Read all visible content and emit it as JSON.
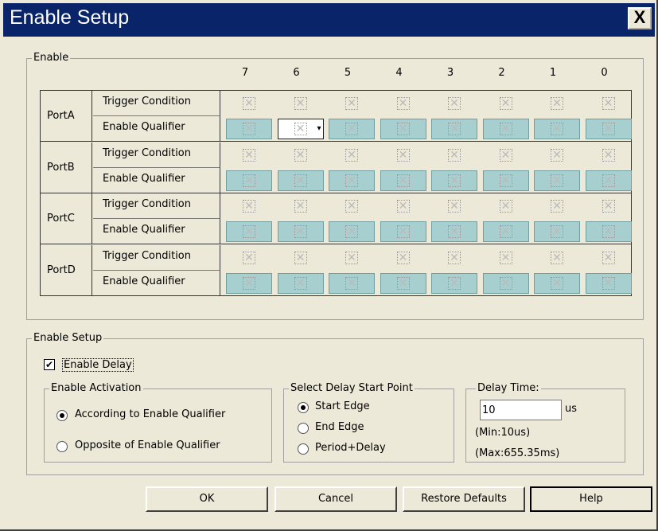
{
  "window": {
    "title": "Enable Setup",
    "close_glyph": "X"
  },
  "enable_group": {
    "legend": "Enable",
    "bits": [
      "7",
      "6",
      "5",
      "4",
      "3",
      "2",
      "1",
      "0"
    ],
    "row_labels": {
      "trigger": "Trigger Condition",
      "qualifier": "Enable Qualifier"
    },
    "ports": [
      "PortA",
      "PortB",
      "PortC",
      "PortD"
    ],
    "selected_cell": {
      "port": "PortA",
      "bit": "6"
    }
  },
  "setup_group": {
    "legend": "Enable Setup",
    "enable_delay": {
      "label": "Enable Delay",
      "checked": true
    },
    "activation": {
      "legend": "Enable Activation",
      "options": [
        "According to Enable Qualifier",
        "Opposite of Enable Qualifier"
      ],
      "selected": 0
    },
    "start_point": {
      "legend": "Select Delay Start Point",
      "options": [
        "Start Edge",
        "End Edge",
        "Period+Delay"
      ],
      "selected": 0
    },
    "delay_time": {
      "legend": "Delay Time:",
      "value": "10",
      "unit": "us",
      "min_text": "(Min:10us)",
      "max_text": "(Max:655.35ms)"
    }
  },
  "buttons": {
    "ok": "OK",
    "cancel": "Cancel",
    "restore": "Restore Defaults",
    "help": "Help"
  },
  "colors": {
    "titlebar": "#0a246a",
    "dialog_bg": "#ece9d8",
    "qualifier_cell": "#a7cfcf"
  }
}
